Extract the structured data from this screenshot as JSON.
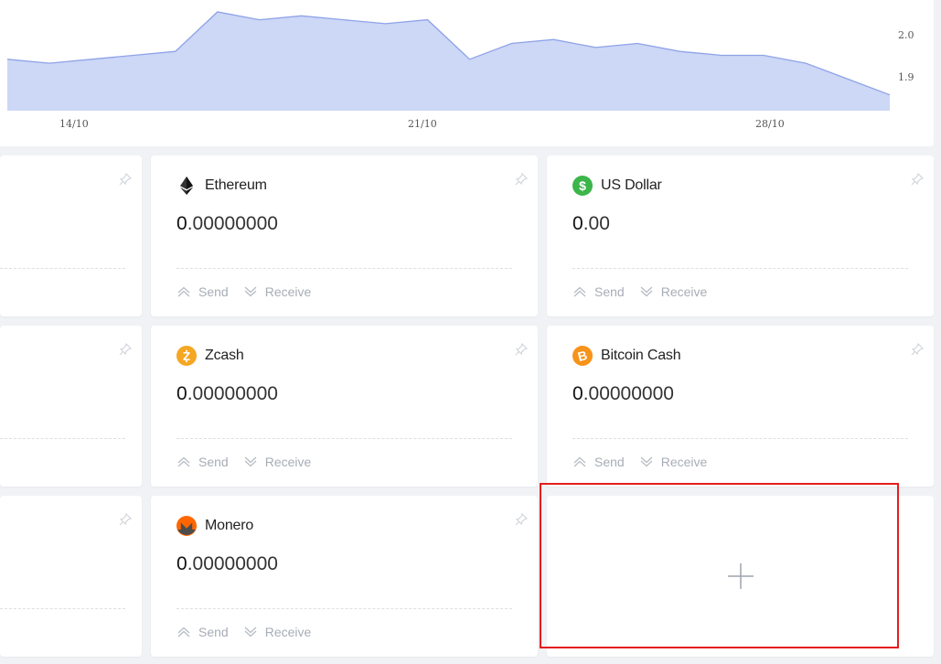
{
  "chart": {
    "x_tick_labels": [
      "14/10",
      "21/10",
      "28/10"
    ],
    "y_tick_labels": [
      "2.0",
      "1.9"
    ],
    "fill_color": "#cdd7f6",
    "line_color": "#8ea3e8"
  },
  "chart_data": {
    "type": "area",
    "x": [
      "10/10",
      "10/11",
      "10/12",
      "10/13",
      "10/14",
      "10/15",
      "10/16",
      "10/17",
      "10/18",
      "10/19",
      "10/20",
      "10/21",
      "10/22",
      "10/23",
      "10/24",
      "10/25",
      "10/26",
      "10/27",
      "10/28",
      "10/29",
      "10/30",
      "10/31"
    ],
    "values": [
      1.95,
      1.94,
      1.95,
      1.96,
      1.97,
      2.07,
      2.05,
      2.06,
      2.05,
      2.04,
      2.05,
      1.95,
      1.99,
      2.0,
      1.98,
      1.99,
      1.97,
      1.96,
      1.96,
      1.94,
      1.9,
      1.86
    ],
    "x_tick_labels": [
      "14/10",
      "21/10",
      "28/10"
    ],
    "y_tick_labels": [
      "2.0",
      "1.9"
    ],
    "ylim": [
      1.82,
      2.1
    ],
    "grid": false,
    "legend": "none"
  },
  "cards": [
    {
      "name": "",
      "balance_int": "",
      "balance_dec": "",
      "send": "",
      "receive": "",
      "icon": ""
    },
    {
      "name": "Ethereum",
      "balance_int": "0",
      "balance_dec": ".00000000",
      "send": "Send",
      "receive": "Receive",
      "icon": "ethereum-icon"
    },
    {
      "name": "US Dollar",
      "balance_int": "0",
      "balance_dec": ".00",
      "send": "Send",
      "receive": "Receive",
      "icon": "dollar-icon",
      "icon_color": "#3cb54a"
    },
    {
      "name": "Zcash",
      "balance_int": "0",
      "balance_dec": ".00000000",
      "send": "Send",
      "receive": "Receive",
      "icon": "zcash-icon",
      "icon_color": "#f5a623"
    },
    {
      "name": "Bitcoin Cash",
      "balance_int": "0",
      "balance_dec": ".00000000",
      "send": "Send",
      "receive": "Receive",
      "icon": "bitcoin-cash-icon",
      "icon_color": "#f7931a"
    },
    {
      "name": "Monero",
      "balance_int": "0",
      "balance_dec": ".00000000",
      "send": "Send",
      "receive": "Receive",
      "icon": "monero-icon",
      "icon_color": "#ff6600"
    }
  ],
  "add_card": {
    "icon": "plus-icon",
    "highlight_color": "#e41e1e"
  }
}
